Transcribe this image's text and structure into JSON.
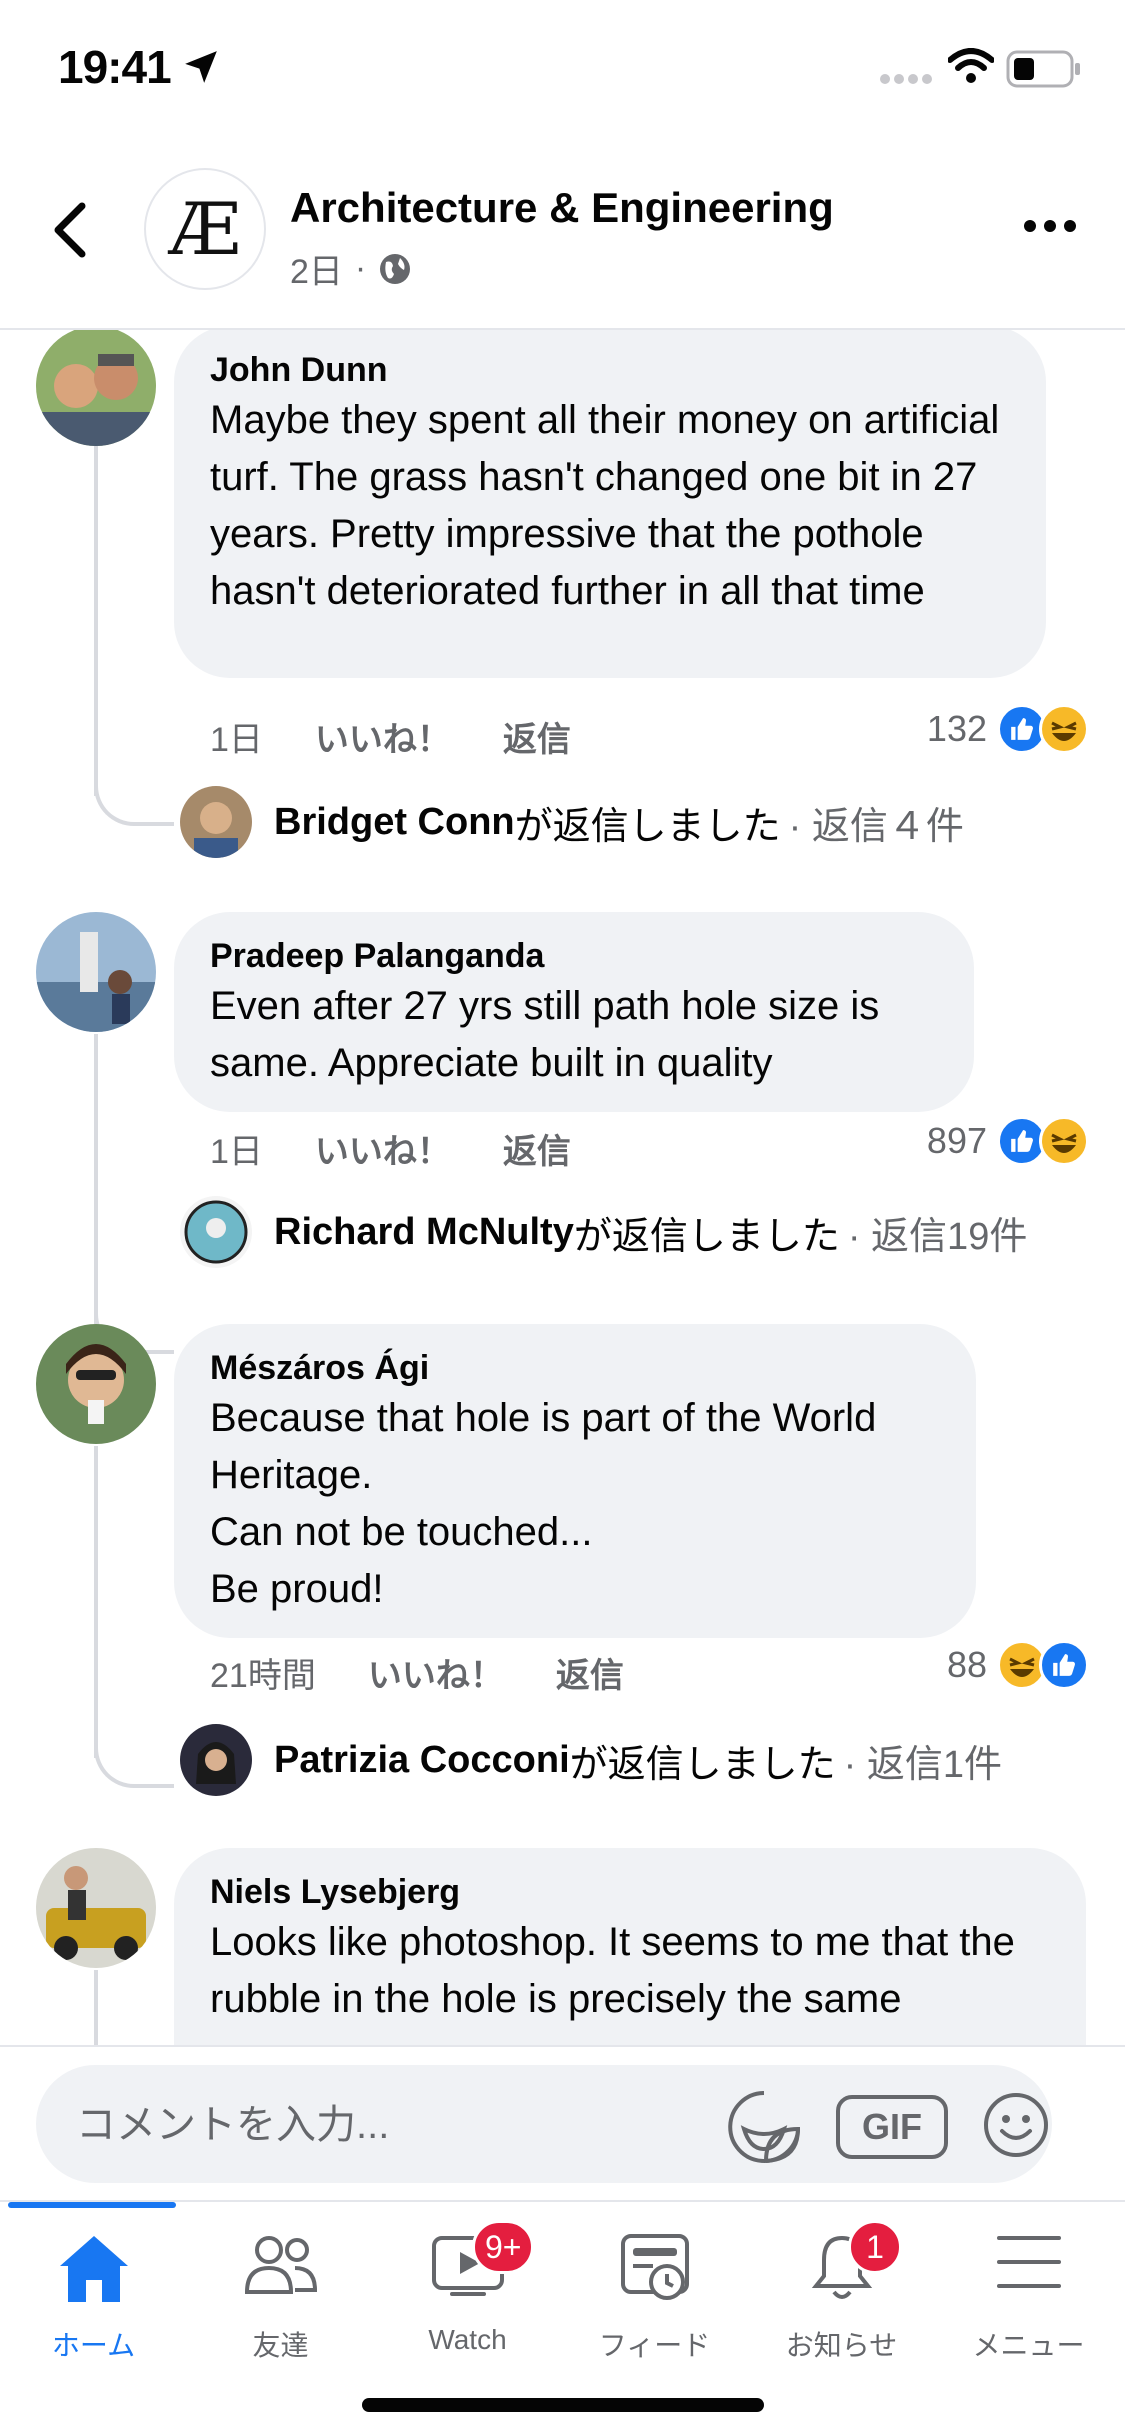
{
  "status_bar": {
    "time": "19:41"
  },
  "header": {
    "group_name": "Architecture & Engineering",
    "group_logo": "Æ",
    "post_age": "2日",
    "separator": "·",
    "privacy_icon": "globe-icon"
  },
  "comments": [
    {
      "author": "John Dunn",
      "text": "Maybe they spent all their money on artificial turf.  The grass hasn't changed one bit in 27 years. Pretty impressive that the pothole hasn't deteriorated further in all that time",
      "age": "1日",
      "like_label": "いいね！",
      "reply_label": "返信",
      "reaction_count": "132",
      "reactions": [
        "like",
        "haha"
      ],
      "reply_summary": {
        "name": "Bridget Conn",
        "verb": "が返信しました",
        "count": "· 返信４件"
      }
    },
    {
      "author": "Pradeep Palanganda",
      "text": "Even after 27 yrs still path hole size is same. Appreciate built in quality",
      "age": "1日",
      "like_label": "いいね！",
      "reply_label": "返信",
      "reaction_count": "897",
      "reactions": [
        "like",
        "haha"
      ],
      "reply_summary": {
        "name": "Richard McNulty",
        "verb": "が返信しました",
        "count": "· 返信19件"
      }
    },
    {
      "author": "Mészáros Ági",
      "text_lines": [
        "Because that hole is part of the World Heritage.",
        "Can not be touched...",
        "Be proud!"
      ],
      "age": "21時間",
      "like_label": "いいね！",
      "reply_label": "返信",
      "reaction_count": "88",
      "reactions": [
        "haha",
        "like"
      ],
      "reply_summary": {
        "name": "Patrizia Cocconi",
        "verb": "が返信しました",
        "count": "· 返信1件"
      }
    },
    {
      "author": "Niels Lysebjerg",
      "text": "Looks like photoshop. It seems to me that the rubble in the hole is precisely the same"
    }
  ],
  "comment_input": {
    "placeholder": "コメントを入力...",
    "gif_label": "GIF"
  },
  "tabs": [
    {
      "label": "ホーム",
      "icon": "home-icon",
      "active": true
    },
    {
      "label": "友達",
      "icon": "friends-icon"
    },
    {
      "label": "Watch",
      "icon": "watch-icon",
      "badge": "9+"
    },
    {
      "label": "フィード",
      "icon": "feed-icon"
    },
    {
      "label": "お知らせ",
      "icon": "bell-icon",
      "badge": "1"
    },
    {
      "label": "メニュー",
      "icon": "menu-icon"
    }
  ],
  "colors": {
    "accent": "#1877f2",
    "badge": "#e41e3f",
    "bubble": "#f0f2f5",
    "muted": "#65676b"
  }
}
